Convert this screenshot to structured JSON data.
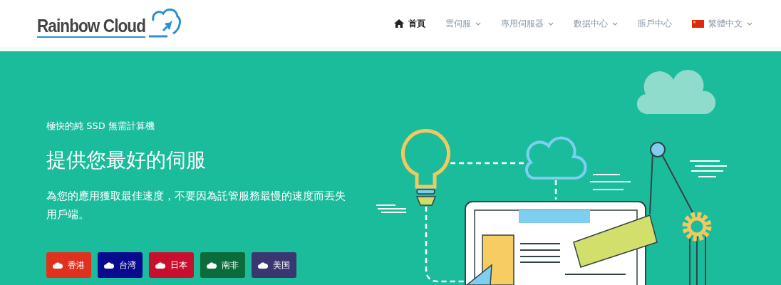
{
  "logo": {
    "text": "Rainbow Cloud"
  },
  "nav": [
    {
      "label": "首頁",
      "selected": true,
      "has_menu": false,
      "kind": "home"
    },
    {
      "label": "雲伺服",
      "selected": false,
      "has_menu": true,
      "kind": "plain"
    },
    {
      "label": "專用伺服器",
      "selected": false,
      "has_menu": true,
      "kind": "plain"
    },
    {
      "label": "数据中心",
      "selected": false,
      "has_menu": true,
      "kind": "plain"
    },
    {
      "label": "賬戶中心",
      "selected": false,
      "has_menu": false,
      "kind": "plain"
    },
    {
      "label": "繁體中文",
      "selected": false,
      "has_menu": true,
      "kind": "language"
    }
  ],
  "hero": {
    "eyebrow": "極快的純 SSD 無需計算機",
    "title": "提供您最好的伺服",
    "text": "為您的應用獲取最佳速度，不要因為託管服務最慢的速度而丟失用戶端。",
    "locations": [
      {
        "label": "香港",
        "color": "#e0301e"
      },
      {
        "label": "台湾",
        "color": "#0a0a8e"
      },
      {
        "label": "日本",
        "color": "#c8102e"
      },
      {
        "label": "南非",
        "color": "#0b6b3a"
      },
      {
        "label": "美国",
        "color": "#3a3670"
      }
    ]
  }
}
